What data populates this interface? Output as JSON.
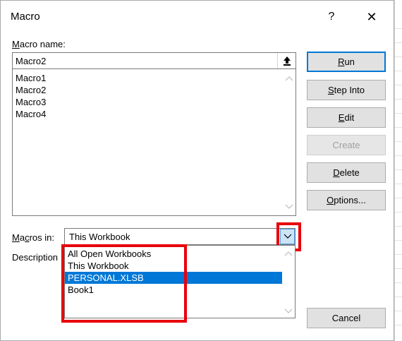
{
  "window": {
    "title": "Macro",
    "help_glyph": "?",
    "close_glyph": "✕"
  },
  "macro_name": {
    "label_prefix": "",
    "label_accel": "M",
    "label_rest": "acro name:",
    "value": "Macro2"
  },
  "macro_list": {
    "items": [
      "Macro1",
      "Macro2",
      "Macro3",
      "Macro4"
    ]
  },
  "buttons": {
    "run_accel": "R",
    "run_rest": "un",
    "step_accel": "S",
    "step_rest": "tep Into",
    "edit_accel": "E",
    "edit_rest": "dit",
    "create": "Create",
    "delete_accel": "D",
    "delete_rest": "elete",
    "options_accel": "O",
    "options_rest": "ptions...",
    "cancel": "Cancel"
  },
  "macros_in": {
    "label_accel": "M",
    "label_rest1": "a",
    "label_accel2": "c",
    "label_rest2": "ros in:",
    "selected": "This Workbook",
    "options": [
      "All Open Workbooks",
      "This Workbook",
      "PERSONAL.XLSB",
      "Book1"
    ],
    "highlighted_index": 2
  },
  "description": {
    "label": "Description"
  },
  "colors": {
    "accent": "#0078d7",
    "highlight_box": "#e8000a"
  }
}
